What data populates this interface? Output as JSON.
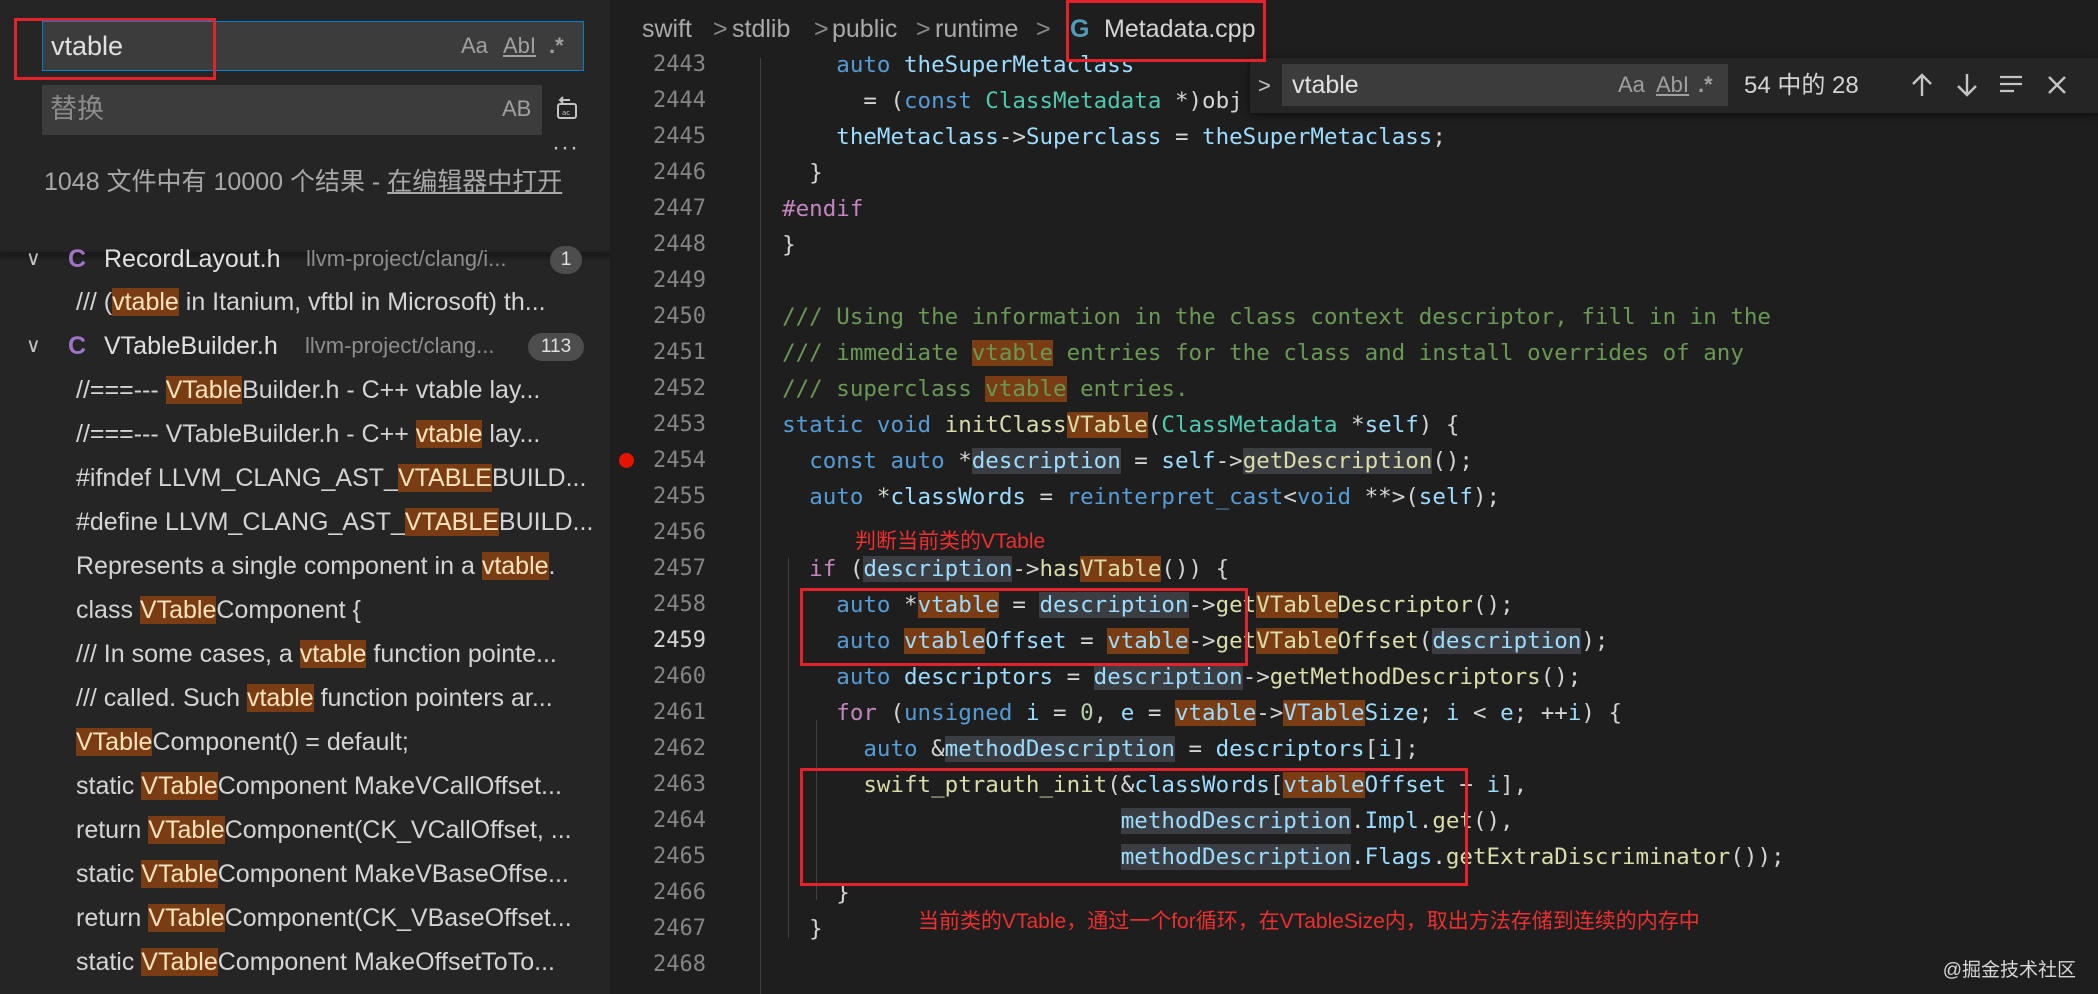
{
  "search": {
    "query": "vtable",
    "replace_placeholder": "替换",
    "opt_case": "Aa",
    "opt_word": "AbI",
    "opt_regex": ".*",
    "opt_preserve_case": "AB",
    "more": "···",
    "summary": "1048 文件中有 10000 个结果 - ",
    "open_in_editor": "在编辑器中打开"
  },
  "results": {
    "files": [
      {
        "chevron": "∨",
        "icon": "C",
        "name": "RecordLayout.h",
        "path": "llvm-project/clang/i...",
        "count": "1"
      },
      {
        "chevron": "∨",
        "icon": "C",
        "name": "VTableBuilder.h",
        "path": "llvm-project/clang...",
        "count": "113"
      }
    ],
    "file1_match": {
      "pre": "/// (",
      "hit": "vtable",
      "post": " in Itanium, vftbl in Microsoft) th..."
    },
    "matches": [
      {
        "pre": "//===--- ",
        "hit": "VTable",
        "post": "Builder.h - C++ vtable lay..."
      },
      {
        "pre": "//===--- VTableBuilder.h - C++ ",
        "hit": "vtable",
        "post": " lay..."
      },
      {
        "pre": "#ifndef LLVM_CLANG_AST_",
        "hit": "VTABLE",
        "post": "BUILD..."
      },
      {
        "pre": "#define LLVM_CLANG_AST_",
        "hit": "VTABLE",
        "post": "BUILD..."
      },
      {
        "pre": "Represents a single component in a ",
        "hit": "vtable",
        "post": "."
      },
      {
        "pre": "class ",
        "hit": "VTable",
        "post": "Component {"
      },
      {
        "pre": "/// In some cases, a ",
        "hit": "vtable",
        "post": " function pointe..."
      },
      {
        "pre": "/// called. Such ",
        "hit": "vtable",
        "post": " function pointers ar..."
      },
      {
        "pre": "",
        "hit": "VTable",
        "post": "Component() = default;"
      },
      {
        "pre": "static ",
        "hit": "VTable",
        "post": "Component MakeVCallOffset..."
      },
      {
        "pre": "return ",
        "hit": "VTable",
        "post": "Component(CK_VCallOffset, ..."
      },
      {
        "pre": "static ",
        "hit": "VTable",
        "post": "Component MakeVBaseOffse..."
      },
      {
        "pre": "return ",
        "hit": "VTable",
        "post": "Component(CK_VBaseOffset..."
      },
      {
        "pre": "static ",
        "hit": "VTable",
        "post": "Component MakeOffsetToTo..."
      }
    ]
  },
  "breadcrumb": {
    "items": [
      "swift",
      "stdlib",
      "public",
      "runtime"
    ],
    "separator": ">",
    "file": "Metadata.cpp",
    "file_icon": "G"
  },
  "find_widget": {
    "toggle": ">",
    "query": "vtable",
    "opt_case": "Aa",
    "opt_word": "AbI",
    "opt_regex": ".*",
    "count": "54 中的 28"
  },
  "editor": {
    "line_numbers": [
      "2443",
      "2444",
      "2445",
      "2446",
      "2447",
      "2448",
      "2449",
      "2450",
      "2451",
      "2452",
      "2453",
      "2454",
      "2455",
      "2456",
      "2457",
      "2458",
      "2459",
      "2460",
      "2461",
      "2462",
      "2463",
      "2464",
      "2465",
      "2466",
      "2467",
      "2468"
    ],
    "current_line": "2459",
    "breakpoint_line": "2454"
  },
  "annotations": {
    "note_hasvtable": "判断当前类的VTable",
    "note_loop": "当前类的VTable，通过一个for循环，在VTableSize内，取出方法存储到连续的内存中"
  },
  "watermark": "@掘金技术社区",
  "colors": {
    "annotation_red": "#e3232b",
    "match_highlight": "#7a3d13",
    "focus_border": "#007fd4"
  }
}
